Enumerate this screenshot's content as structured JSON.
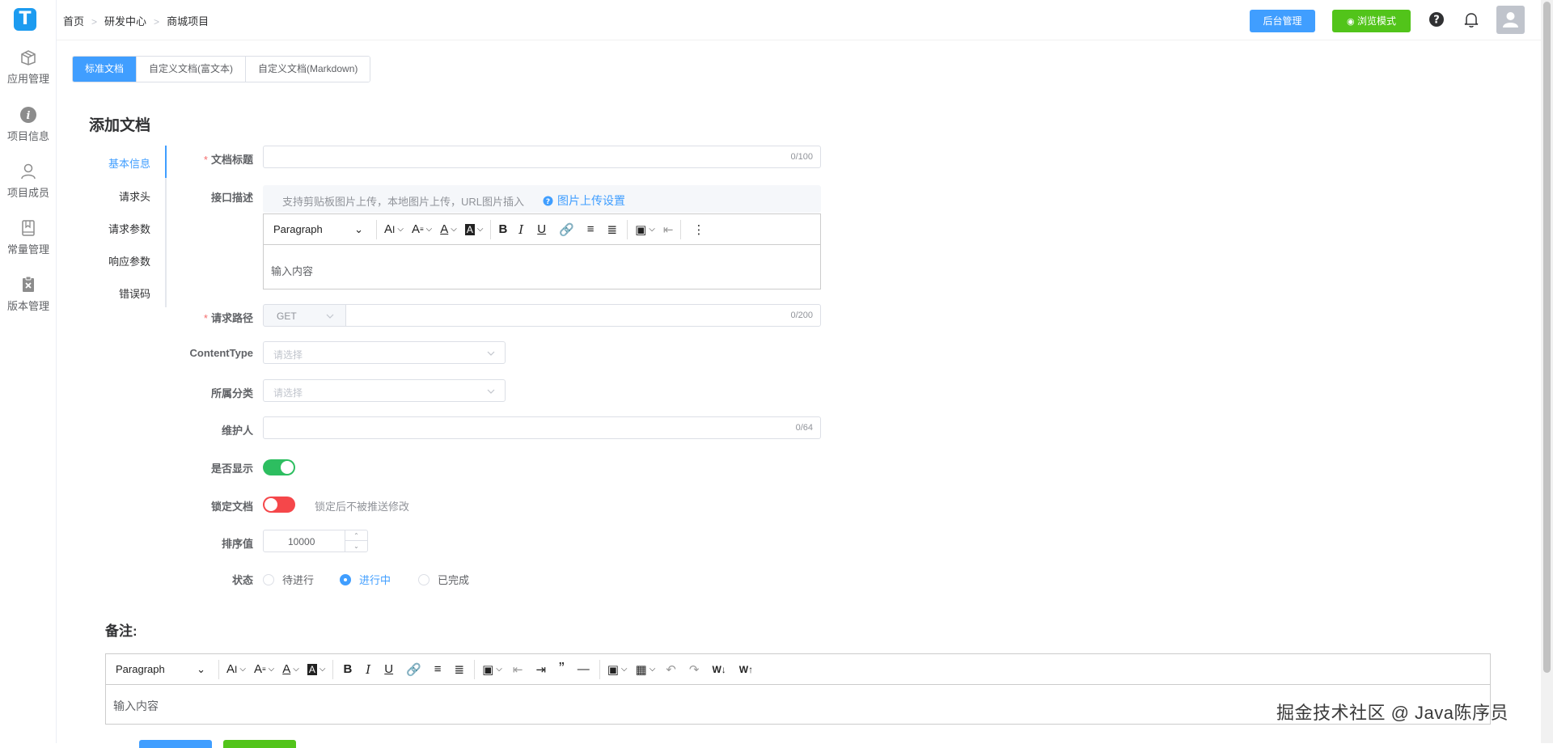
{
  "app": {
    "logo_letter": "T",
    "brand_color": "#1c9bf0",
    "accent": "#409eff",
    "success": "#52c41a",
    "danger": "#f5474a"
  },
  "sidebar": {
    "items": [
      {
        "label": "应用管理",
        "icon": "package-icon"
      },
      {
        "label": "项目信息",
        "icon": "info-icon"
      },
      {
        "label": "项目成员",
        "icon": "user-icon"
      },
      {
        "label": "常量管理",
        "icon": "book-icon"
      },
      {
        "label": "版本管理",
        "icon": "clipboard-x-icon"
      }
    ]
  },
  "breadcrumb": {
    "items": [
      "首页",
      "研发中心",
      "商城项目"
    ]
  },
  "header": {
    "admin_button": "后台管理",
    "browse_button": "浏览模式"
  },
  "tabs": [
    {
      "label": "标准文档",
      "active": true
    },
    {
      "label": "自定义文档(富文本)",
      "active": false
    },
    {
      "label": "自定义文档(Markdown)",
      "active": false
    }
  ],
  "page": {
    "title": "添加文档"
  },
  "section_nav": {
    "items": [
      "基本信息",
      "请求头",
      "请求参数",
      "响应参数",
      "错误码"
    ],
    "active": "基本信息"
  },
  "form": {
    "title": {
      "label": "文档标题",
      "value": "",
      "count": "0/100"
    },
    "description": {
      "label": "接口描述",
      "hint": "支持剪贴板图片上传，本地图片上传，URL图片插入",
      "upload_link": "图片上传设置"
    },
    "editor": {
      "block_format": "Paragraph",
      "placeholder": "输入内容"
    },
    "path": {
      "label": "请求路径",
      "method": "GET",
      "value": "",
      "count": "0/200"
    },
    "content_type": {
      "label": "ContentType",
      "placeholder": "请选择"
    },
    "category": {
      "label": "所属分类",
      "placeholder": "请选择"
    },
    "maintainer": {
      "label": "维护人",
      "value": "",
      "count": "0/64"
    },
    "visible": {
      "label": "是否显示",
      "on": true
    },
    "locked": {
      "label": "锁定文档",
      "on": false,
      "note": "锁定后不被推送修改"
    },
    "sort": {
      "label": "排序值",
      "value": "10000"
    },
    "status": {
      "label": "状态",
      "options": [
        "待进行",
        "进行中",
        "已完成"
      ],
      "selected": "进行中"
    }
  },
  "remark": {
    "label": "备注:",
    "block_format": "Paragraph",
    "placeholder": "输入内容"
  },
  "watermark": "掘金技术社区 @ Java陈序员"
}
